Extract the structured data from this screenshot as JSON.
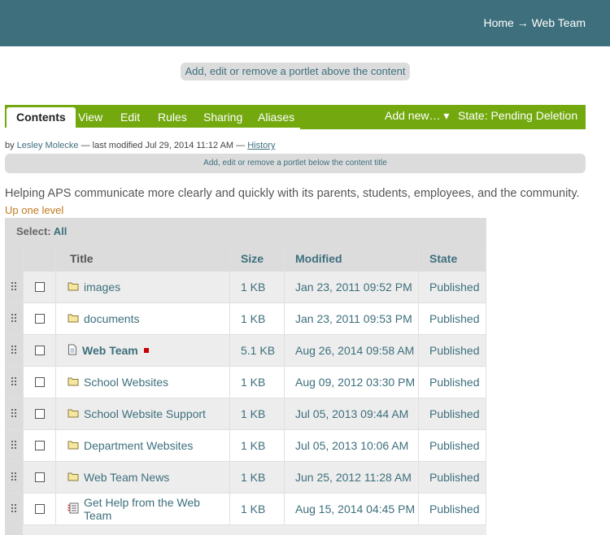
{
  "breadcrumb": {
    "home": "Home",
    "arrow": "→",
    "current": "Web Team"
  },
  "portlet_above": "Add, edit or remove a portlet above the content",
  "tabs": [
    "Contents",
    "View",
    "Edit",
    "Rules",
    "Sharing",
    "Aliases"
  ],
  "actions": {
    "add_new": "Add new… ▾",
    "state": "State: Pending Deletion ▾"
  },
  "byline": {
    "by": "by",
    "author": "Lesley Molecke",
    "modified": "— last modified Jul 29, 2014 11:12 AM —",
    "history": "History"
  },
  "portlet_below": "Add, edit or remove a portlet below the content title",
  "description": "Helping APS communicate more clearly and quickly with its parents, students, employees, and the community.",
  "up_one_level": "Up one level",
  "select": {
    "label": "Select:",
    "all": "All"
  },
  "columns": {
    "title": "Title",
    "size": "Size",
    "modified": "Modified",
    "state": "State"
  },
  "rows": [
    {
      "icon": "folder-icon",
      "title": "images",
      "size": "1 KB",
      "modified": "Jan 23, 2011 09:52 PM",
      "state": "Published"
    },
    {
      "icon": "folder-icon",
      "title": "documents",
      "size": "1 KB",
      "modified": "Jan 23, 2011 09:53 PM",
      "state": "Published"
    },
    {
      "icon": "page-icon",
      "title": "Web Team",
      "size": "5.1 KB",
      "modified": "Aug 26, 2014 09:58 AM",
      "state": "Published"
    },
    {
      "icon": "folder-icon",
      "title": "School Websites",
      "size": "1 KB",
      "modified": "Aug 09, 2012 03:30 PM",
      "state": "Published"
    },
    {
      "icon": "folder-icon",
      "title": "School Website Support",
      "size": "1 KB",
      "modified": "Jul 05, 2013 09:44 AM",
      "state": "Published"
    },
    {
      "icon": "folder-icon",
      "title": "Department Websites",
      "size": "1 KB",
      "modified": "Jul 05, 2013 10:06 AM",
      "state": "Published"
    },
    {
      "icon": "folder-icon",
      "title": "Web Team News",
      "size": "1 KB",
      "modified": "Jun 25, 2012 11:28 AM",
      "state": "Published"
    },
    {
      "icon": "form-icon",
      "title": "Get Help from the Web Team",
      "size": "1 KB",
      "modified": "Aug 15, 2014 04:45 PM",
      "state": "Published"
    }
  ],
  "colors": {
    "header": "#3d6f7c",
    "tabbar": "#73a90f",
    "link": "#3d6f7c",
    "uplevel": "#c07a1e",
    "lock": "#cc0000"
  }
}
